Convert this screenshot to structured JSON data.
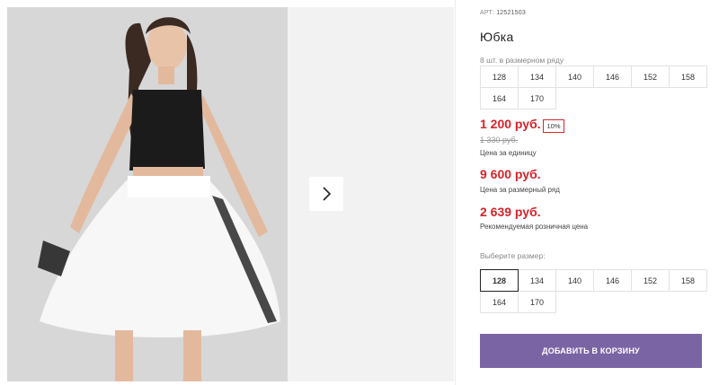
{
  "product": {
    "sku_label": "АРТ:",
    "sku_value": "12521503",
    "title": "Юбка",
    "pack_note": "8 шт. в размерном ряду",
    "pack_sizes": [
      "128",
      "134",
      "140",
      "146",
      "152",
      "158",
      "164",
      "170"
    ]
  },
  "prices": {
    "unit_price": "1 200 руб.",
    "discount": "10%",
    "old_price": "1 330 руб.",
    "unit_label": "Цена за единицу",
    "pack_price": "9 600 руб.",
    "pack_label": "Цена за размерный ряд",
    "rrp_price": "2 639 руб.",
    "rrp_label": "Рекомендуемая розничная цена"
  },
  "size_select": {
    "label": "Выберите размер:",
    "selected": "128",
    "options": [
      "128",
      "134",
      "140",
      "146",
      "152",
      "158",
      "164",
      "170"
    ]
  },
  "actions": {
    "add_to_cart": "ДОБАВИТЬ В КОРЗИНУ"
  },
  "gallery": {
    "next_icon": "chevron-right-icon"
  },
  "colors": {
    "accent_price": "#d8232a",
    "button": "#7b64a4"
  }
}
